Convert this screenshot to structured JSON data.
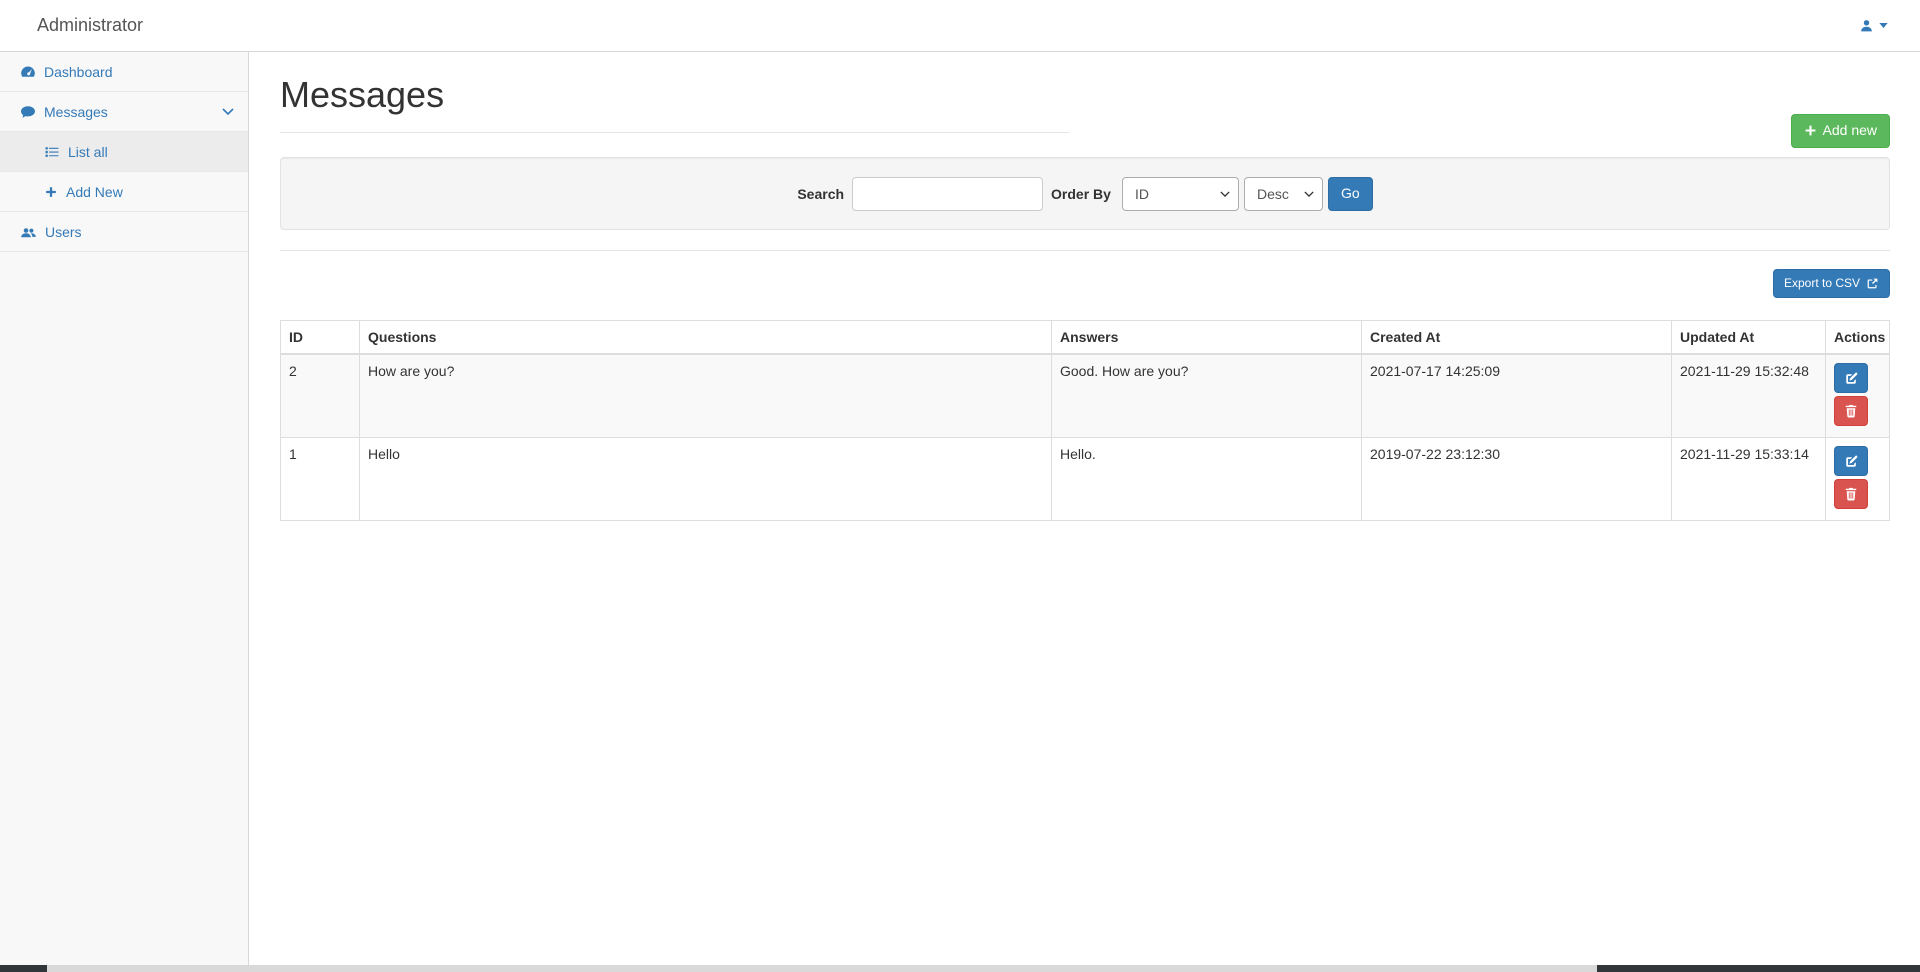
{
  "topbar": {
    "title": "Administrator"
  },
  "sidebar": {
    "items": [
      {
        "label": "Dashboard",
        "icon": "tachometer-icon"
      },
      {
        "label": "Messages",
        "icon": "comment-icon",
        "expanded": true
      },
      {
        "label": "List all",
        "icon": "list-icon",
        "active": true
      },
      {
        "label": "Add New",
        "icon": "plus-icon"
      },
      {
        "label": "Users",
        "icon": "users-icon"
      }
    ]
  },
  "page": {
    "title": "Messages",
    "add_new_label": "Add new",
    "export_label": "Export to CSV"
  },
  "filters": {
    "search_label": "Search",
    "search_value": "",
    "order_by_label": "Order By",
    "order_field_selected": "ID",
    "order_dir_selected": "Desc",
    "go_label": "Go"
  },
  "table": {
    "columns": [
      "ID",
      "Questions",
      "Answers",
      "Created At",
      "Updated At",
      "Actions"
    ],
    "rows": [
      {
        "id": "2",
        "question": "How are you?",
        "answer": "Good. How are you?",
        "created_at": "2021-07-17 14:25:09",
        "updated_at": "2021-11-29 15:32:48"
      },
      {
        "id": "1",
        "question": "Hello",
        "answer": "Hello.",
        "created_at": "2019-07-22 23:12:30",
        "updated_at": "2021-11-29 15:33:14"
      }
    ]
  },
  "colors": {
    "accent_blue": "#337ab7",
    "success_green": "#5cb85c",
    "danger_red": "#d9534f",
    "sidebar_bg": "#f8f8f8",
    "well_bg": "#f5f5f5",
    "stripe": "#f9f9f9"
  }
}
